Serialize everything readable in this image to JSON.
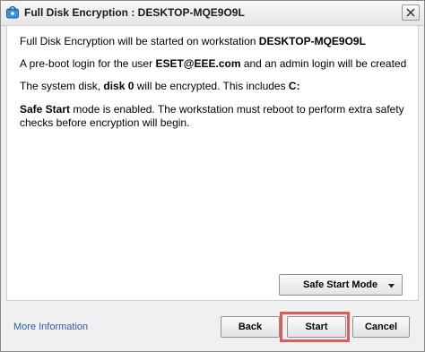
{
  "window": {
    "title": "Full Disk Encryption : DESKTOP-MQE9O9L",
    "app_icon": "eset-encryption-icon",
    "close_icon": "close-icon"
  },
  "messages": {
    "line1_prefix": "Full Disk Encryption will be started on workstation ",
    "line1_bold": "DESKTOP-MQE9O9L",
    "line2_prefix": "A pre-boot login for the user ",
    "line2_bold": "ESET@EEE.com",
    "line2_suffix": " and an admin login will be created",
    "line3_prefix": "The system disk, ",
    "line3_bold": "disk 0",
    "line3_middle": " will be encrypted. This includes ",
    "line3_bold2": "C:",
    "line4_bold": "Safe Start",
    "line4_suffix": " mode is enabled. The workstation must reboot to perform extra safety checks before encryption will begin."
  },
  "mode_dropdown": {
    "label": "Safe Start Mode",
    "caret_icon": "chevron-down-icon"
  },
  "footer": {
    "more_info_link": "More Information",
    "back_label": "Back",
    "start_label": "Start",
    "cancel_label": "Cancel"
  },
  "colors": {
    "link": "#2a5db0",
    "highlight": "#e05a5a"
  }
}
